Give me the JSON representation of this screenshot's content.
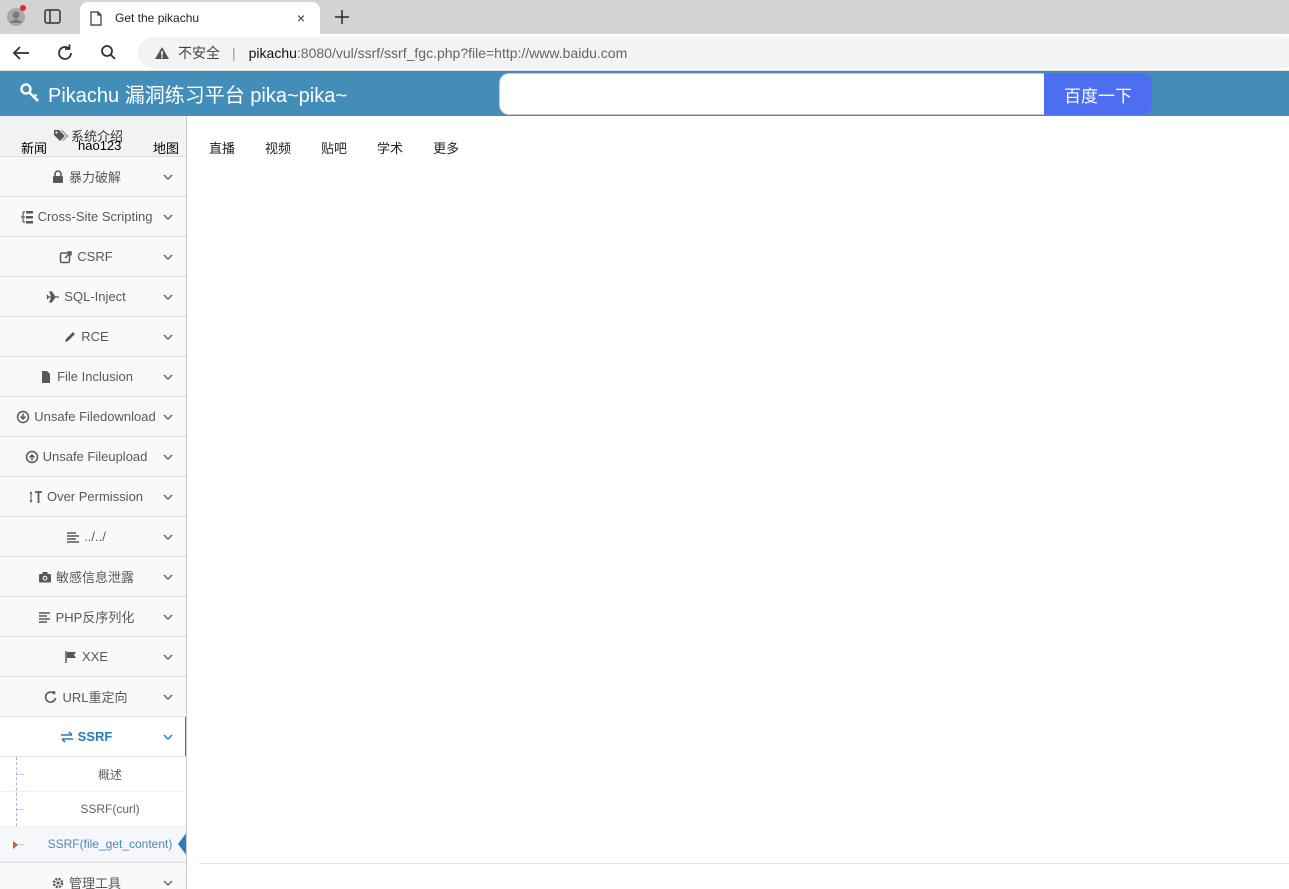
{
  "browser": {
    "tab_title": "Get the pikachu",
    "tab_close": "×",
    "security_label": "不安全",
    "url_host": "pikachu",
    "url_rest": ":8080/vul/ssrf/ssrf_fgc.php?file=http://www.baidu.com"
  },
  "header": {
    "brand": "Pikachu 漏洞练习平台 pika~pika~",
    "search_value": "",
    "search_button": "百度一下",
    "color": "#438eb9"
  },
  "sidebar": {
    "intro": "系统介绍",
    "top_links": [
      "新闻",
      "hao123",
      "地图"
    ],
    "items": [
      {
        "label": "暴力破解",
        "icon": "lock-icon"
      },
      {
        "label": "Cross-Site Scripting",
        "icon": "sitemap-icon"
      },
      {
        "label": "CSRF",
        "icon": "share-icon"
      },
      {
        "label": "SQL-Inject",
        "icon": "plane-icon"
      },
      {
        "label": "RCE",
        "icon": "pencil-icon"
      },
      {
        "label": "File Inclusion",
        "icon": "file-icon"
      },
      {
        "label": "Unsafe Filedownload",
        "icon": "download-icon"
      },
      {
        "label": "Unsafe Fileupload",
        "icon": "upload-icon"
      },
      {
        "label": "Over Permission",
        "icon": "text-height-icon"
      },
      {
        "label": "../../",
        "icon": "align-icon"
      },
      {
        "label": "敏感信息泄露",
        "icon": "camera-icon"
      },
      {
        "label": "PHP反序列化",
        "icon": "align-left-icon"
      },
      {
        "label": "XXE",
        "icon": "flag-icon"
      },
      {
        "label": "URL重定向",
        "icon": "repeat-icon"
      },
      {
        "label": "SSRF",
        "icon": "exchange-icon"
      }
    ],
    "ssrf_sub": [
      "概述",
      "SSRF(curl)",
      "SSRF(file_get_content)"
    ],
    "last_item": {
      "label": "管理工具",
      "icon": "gear-icon"
    },
    "active_color": "#2b7dbc"
  },
  "baidu": {
    "nav": [
      "直播",
      "视频",
      "贴吧",
      "学术",
      "更多"
    ]
  }
}
